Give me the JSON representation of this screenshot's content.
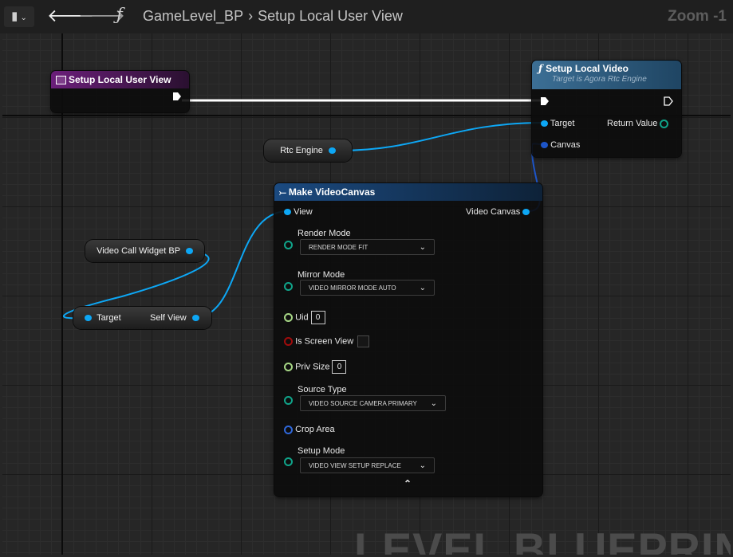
{
  "toolbar": {
    "bookmark_icon": "bookmark-icon",
    "back_icon": "arrow-left-icon",
    "forward_icon": "arrow-right-icon",
    "function_symbol": "ƒ",
    "breadcrumb_parent": "GameLevel_BP",
    "breadcrumb_current": "Setup Local User View",
    "zoom": "Zoom -1"
  },
  "event_node": {
    "title": "Setup Local User View",
    "color": "#6b1f7a"
  },
  "setup_video_node": {
    "title": "Setup Local Video",
    "subtitle": "Target is Agora Rtc Engine",
    "pins": {
      "target": "Target",
      "return_value": "Return Value",
      "canvas": "Canvas"
    },
    "color": "#2d5a7e"
  },
  "rtc_engine_node": {
    "label": "Rtc Engine"
  },
  "widget_node": {
    "label": "Video Call Widget BP"
  },
  "target_selfview_node": {
    "target": "Target",
    "self_view": "Self View"
  },
  "make_canvas_node": {
    "title": "Make VideoCanvas",
    "color": "#163e6e",
    "pins": {
      "view": "View",
      "video_canvas": "Video Canvas",
      "render_mode_label": "Render Mode",
      "render_mode_value": "RENDER MODE FIT",
      "mirror_mode_label": "Mirror Mode",
      "mirror_mode_value": "VIDEO MIRROR MODE AUTO",
      "uid_label": "Uid",
      "uid_value": "0",
      "is_screen_view_label": "Is Screen View",
      "is_screen_view_checked": false,
      "priv_size_label": "Priv Size",
      "priv_size_value": "0",
      "source_type_label": "Source Type",
      "source_type_value": "VIDEO SOURCE CAMERA PRIMARY",
      "crop_area_label": "Crop Area",
      "setup_mode_label": "Setup Mode",
      "setup_mode_value": "VIDEO VIEW SETUP REPLACE"
    },
    "collapse_icon": "chevron-up-icon"
  },
  "watermark": "LEVEL BLUEPRINT",
  "colors": {
    "object_pin": "#0da7f5",
    "struct_pin": "#1d55c9",
    "exec_wire": "#ffffff",
    "object_wire": "#0da7f5"
  }
}
